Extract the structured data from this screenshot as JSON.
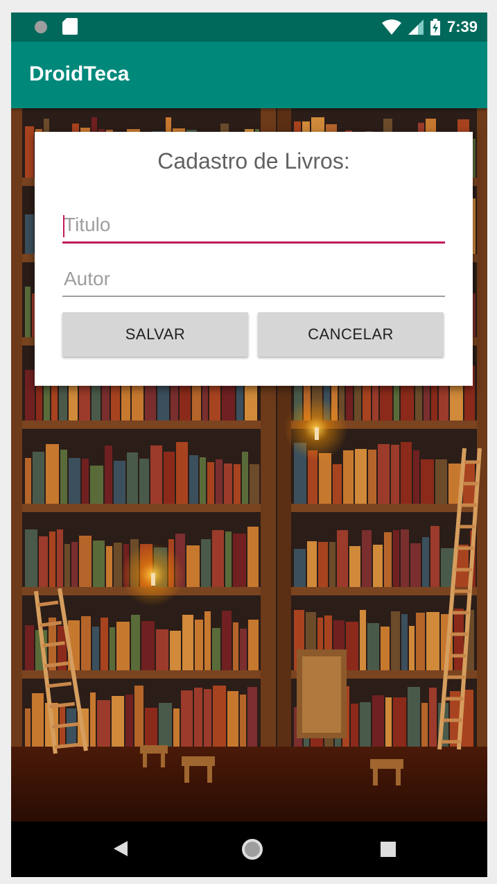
{
  "status_bar": {
    "time": "7:39"
  },
  "app_bar": {
    "title": "DroidTeca"
  },
  "dialog": {
    "title": "Cadastro de Livros:",
    "titulo_placeholder": "Titulo",
    "autor_placeholder": "Autor",
    "save_label": "SALVAR",
    "cancel_label": "CANCELAR"
  },
  "nav": {
    "back_icon": "back-triangle-icon",
    "home_icon": "home-circle-icon",
    "recents_icon": "recents-square-icon"
  },
  "colors": {
    "status_bar": "#00695c",
    "app_bar": "#00897b",
    "accent": "#c2185b",
    "button": "#d6d6d6"
  }
}
